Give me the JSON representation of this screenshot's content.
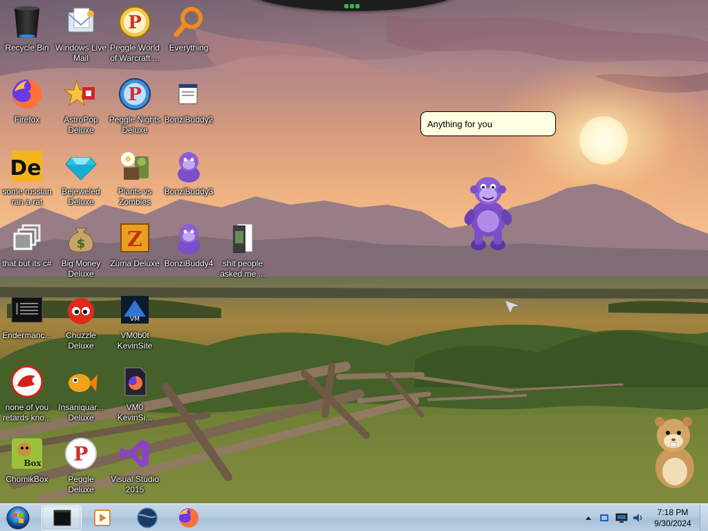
{
  "desktop": {
    "icons": [
      {
        "label": "Recycle Bin"
      },
      {
        "label": "Windows Live Mail"
      },
      {
        "label": "Peggle World of Warcraft ..."
      },
      {
        "label": "Everything"
      },
      {
        "label": "Firefox"
      },
      {
        "label": "AstroPop Deluxe"
      },
      {
        "label": "Peggle Nights Deluxe"
      },
      {
        "label": "BonziBuddy2"
      },
      {
        "label": "some russian ran a rat"
      },
      {
        "label": "Bejeweled Deluxe"
      },
      {
        "label": "Plants vs Zombies"
      },
      {
        "label": "BonziBuddy3"
      },
      {
        "label": "that but its c#"
      },
      {
        "label": "Big Money Deluxe"
      },
      {
        "label": "Zuma Deluxe"
      },
      {
        "label": "BonziBuddy4"
      },
      {
        "label": "shit people asked me ..."
      },
      {
        "label": "Endermanc..."
      },
      {
        "label": "Chuzzle Deluxe"
      },
      {
        "label": "VM0b0t KevinSite"
      },
      {
        "label": "none of you retards kno..."
      },
      {
        "label": "Insaniquar... Deluxe"
      },
      {
        "label": "VM0 KevinSi..."
      },
      {
        "label": "ChomikBox"
      },
      {
        "label": "Peggle Deluxe"
      },
      {
        "label": "Visual Studio 2015"
      }
    ]
  },
  "assistant": {
    "speech": "Anything for you"
  },
  "taskbar": {
    "pinned": [
      {
        "icon": "terminal-icon"
      },
      {
        "icon": "media-player-icon"
      },
      {
        "icon": "globe-icon"
      },
      {
        "icon": "firefox-icon"
      }
    ],
    "clock": {
      "time": "7:18 PM",
      "date": "9/30/2024"
    }
  },
  "colors": {
    "bubble_bg": "#ffffe1",
    "bonzi_purple": "#7a4fc9",
    "taskbar": "#b6cde2"
  }
}
